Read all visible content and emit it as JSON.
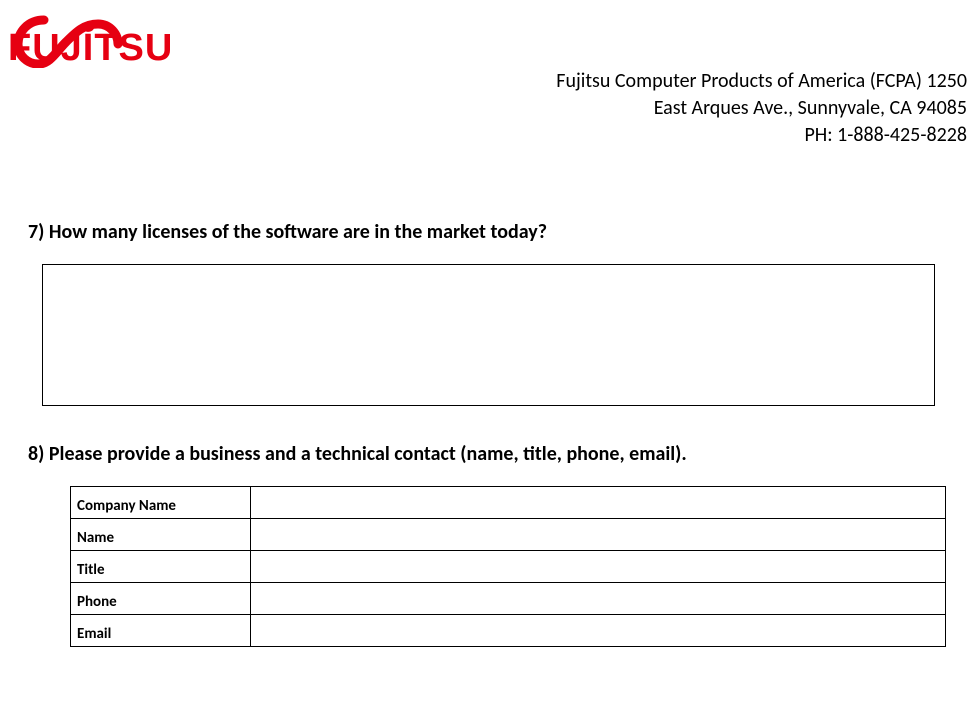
{
  "brand": {
    "name": "FUJITSU",
    "color": "#e60012"
  },
  "header": {
    "line1": "Fujitsu Computer Products of America (FCPA) 1250",
    "line2": "East Arques Ave., Sunnyvale, CA 94085",
    "line3": "PH: 1-888-425-8228"
  },
  "q7": {
    "label": "7) How many licenses of the software are in the market today?",
    "answer": ""
  },
  "q8": {
    "label": "8) Please provide a business and a technical contact (name, title, phone, email).",
    "rows": {
      "company_name_label": "Company Name",
      "company_name_value": "",
      "name_label": "Name",
      "name_value": "",
      "title_label": "Title",
      "title_value": "",
      "phone_label": "Phone",
      "phone_value": "",
      "email_label": "Email",
      "email_value": ""
    }
  }
}
